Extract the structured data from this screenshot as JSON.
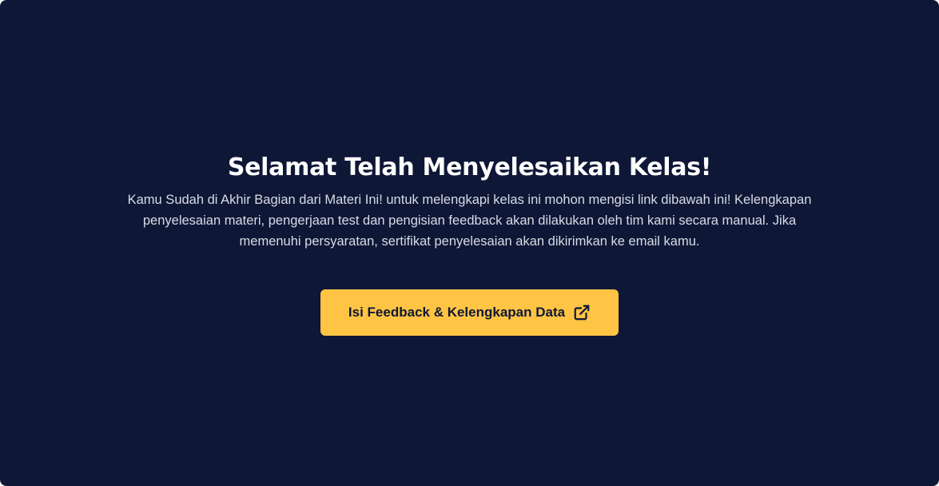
{
  "completion": {
    "title": "Selamat Telah Menyelesaikan Kelas!",
    "description": "Kamu Sudah di Akhir Bagian dari Materi Ini! untuk melengkapi kelas ini mohon mengisi link dibawah ini! Kelengkapan penyelesaian materi, pengerjaan test dan pengisian feedback akan dilakukan oleh tim kami secara manual. Jika memenuhi persyaratan, sertifikat penyelesaian akan dikirimkan ke email kamu.",
    "button_label": "Isi Feedback & Kelengkapan Data",
    "button_icon": "external-link-icon"
  },
  "colors": {
    "background": "#0e1736",
    "accent": "#ffc444",
    "title_text": "#ffffff",
    "body_text": "#d8dbe6"
  }
}
